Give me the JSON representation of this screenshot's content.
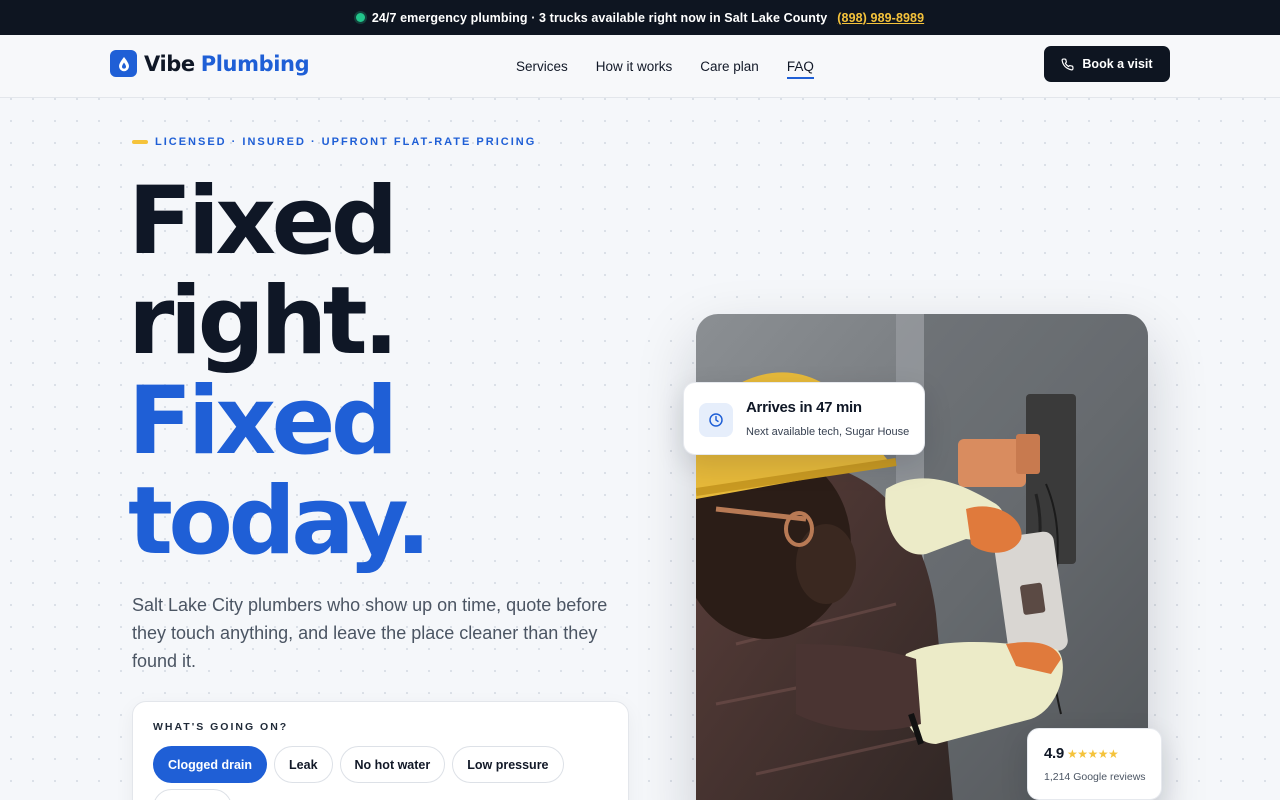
{
  "topbar": {
    "status_text": "24/7 emergency plumbing · 3 trucks available right now in Salt Lake County",
    "phone": "(898) 989-8989",
    "status_color": "#22c58b"
  },
  "brand": {
    "name_part1": "Vibe",
    "name_part2": "Plumbing",
    "icon": "water-drop-icon",
    "accent_color": "#1f5fd6",
    "highlight_color": "#f5c33b"
  },
  "nav": {
    "items": [
      {
        "label": "Services"
      },
      {
        "label": "How it works"
      },
      {
        "label": "Care plan"
      },
      {
        "label": "FAQ",
        "active": true
      }
    ]
  },
  "header": {
    "cta_label": "Book a visit",
    "cta_icon": "phone-icon"
  },
  "hero": {
    "eyebrow": "LICENSED · INSURED · UPFRONT FLAT-RATE PRICING",
    "headline": [
      "Fixed",
      "right.",
      "Fixed",
      "today."
    ],
    "subcopy": "Salt Lake City plumbers who show up on time, quote before they touch anything, and leave the place cleaner than they found it."
  },
  "picker": {
    "label": "WHAT'S GOING ON?",
    "options": [
      "Clogged drain",
      "Leak",
      "No hot water",
      "Low pressure"
    ],
    "selected": "Clogged drain"
  },
  "eta": {
    "icon": "clock-icon",
    "title": "Arrives in 47 min",
    "subtitle": "Next available tech, Sugar House"
  },
  "rating": {
    "score": "4.9",
    "stars": "★★★★★",
    "star_value": 5,
    "reviews": "1,214 Google reviews"
  }
}
